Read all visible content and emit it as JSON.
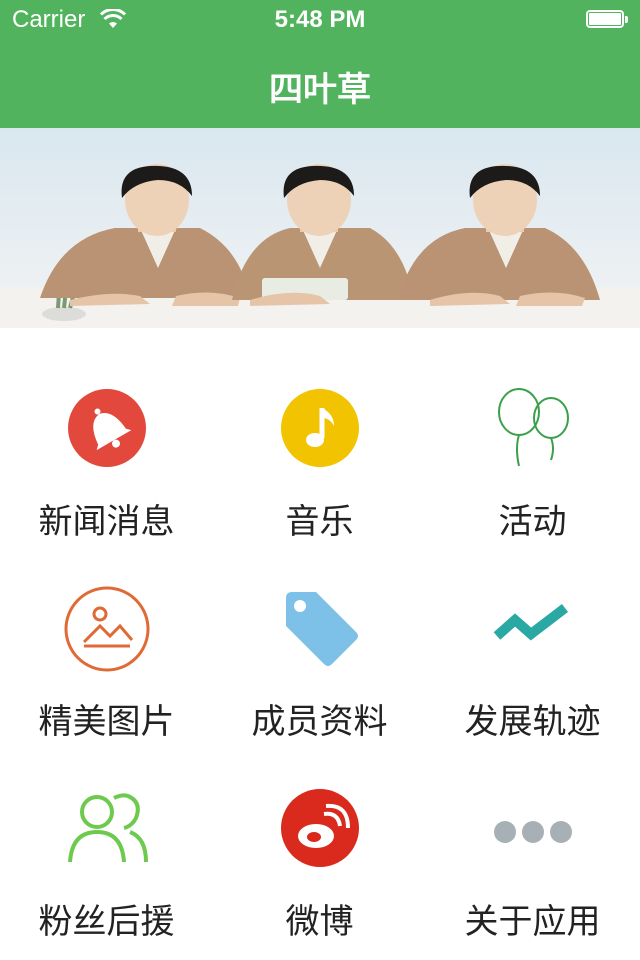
{
  "status_bar": {
    "carrier": "Carrier",
    "time": "5:48 PM"
  },
  "nav": {
    "title": "四叶草"
  },
  "colors": {
    "nav_bg": "#52b35e",
    "news": "#e2493c",
    "music": "#f2c300",
    "activity": "#3aa04a",
    "pictures": "#e06a36",
    "members": "#7ec1e8",
    "timeline": "#2aa8a4",
    "fans": "#6dca4e",
    "weibo": "#d92a1d",
    "about": "#a7b1b5"
  },
  "menu": {
    "items": [
      {
        "label": "新闻消息",
        "icon": "bell-icon"
      },
      {
        "label": "音乐",
        "icon": "music-note-icon"
      },
      {
        "label": "活动",
        "icon": "balloons-icon"
      },
      {
        "label": "精美图片",
        "icon": "picture-icon"
      },
      {
        "label": "成员资料",
        "icon": "tag-icon"
      },
      {
        "label": "发展轨迹",
        "icon": "trend-line-icon"
      },
      {
        "label": "粉丝后援",
        "icon": "people-icon"
      },
      {
        "label": "微博",
        "icon": "weibo-icon"
      },
      {
        "label": "关于应用",
        "icon": "more-dots-icon"
      }
    ]
  }
}
